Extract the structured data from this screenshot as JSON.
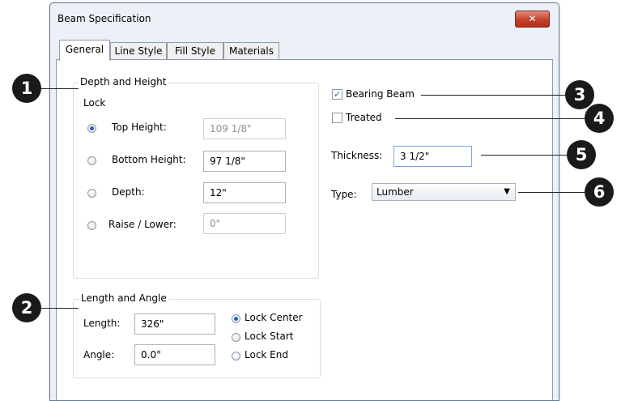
{
  "window": {
    "title": "Beam Specification",
    "close_glyph": "✕"
  },
  "tabs": [
    {
      "label": "General",
      "active": true
    },
    {
      "label": "Line Style",
      "active": false
    },
    {
      "label": "Fill Style",
      "active": false
    },
    {
      "label": "Materials",
      "active": false
    }
  ],
  "depth_height": {
    "legend": "Depth and Height",
    "lock_label": "Lock",
    "rows": [
      {
        "label": "Top Height:",
        "value": "109 1/8\"",
        "selected": true,
        "enabled": false
      },
      {
        "label": "Bottom Height:",
        "value": "97 1/8\"",
        "selected": false,
        "enabled": true
      },
      {
        "label": "Depth:",
        "value": "12\"",
        "selected": false,
        "enabled": true
      },
      {
        "label": "Raise / Lower:",
        "value": "0\"",
        "selected": false,
        "enabled": false
      }
    ]
  },
  "length_angle": {
    "legend": "Length and Angle",
    "length_label": "Length:",
    "length_value": "326\"",
    "angle_label": "Angle:",
    "angle_value": "0.0°",
    "lock_options": [
      {
        "label": "Lock Center",
        "selected": true
      },
      {
        "label": "Lock Start",
        "selected": false
      },
      {
        "label": "Lock End",
        "selected": false
      }
    ]
  },
  "options": {
    "bearing_beam_label": "Bearing Beam",
    "bearing_beam_checked": true,
    "treated_label": "Treated",
    "treated_checked": false,
    "thickness_label": "Thickness:",
    "thickness_value": "3 1/2\"",
    "type_label": "Type:",
    "type_value": "Lumber"
  },
  "callouts": [
    "1",
    "2",
    "3",
    "4",
    "5",
    "6"
  ],
  "colors": {
    "accent": "#1f5ec9",
    "close_button": "#c4412c",
    "callout": "#1a1a1a"
  }
}
